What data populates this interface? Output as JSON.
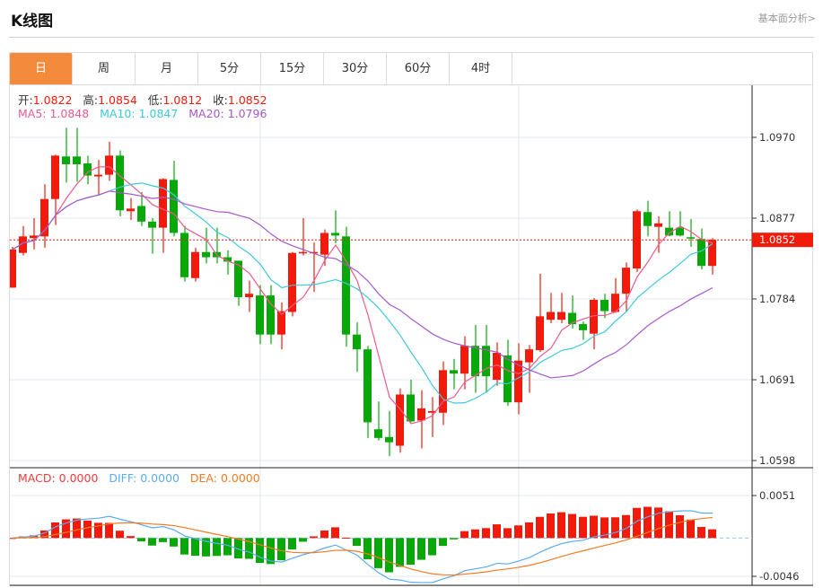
{
  "header": {
    "title": "K线图",
    "more_link": "基本面分析>"
  },
  "tabs": [
    {
      "label": "日",
      "active": true
    },
    {
      "label": "周"
    },
    {
      "label": "月"
    },
    {
      "label": "5分"
    },
    {
      "label": "15分"
    },
    {
      "label": "30分"
    },
    {
      "label": "60分"
    },
    {
      "label": "4时"
    }
  ],
  "info": {
    "open_label": "开:",
    "open": "1.0822",
    "high_label": "高:",
    "high": "1.0854",
    "low_label": "低:",
    "low": "1.0812",
    "close_label": "收:",
    "close": "1.0852",
    "ma5": "MA5: 1.0848",
    "ma10": "MA10: 1.0847",
    "ma20": "MA20: 1.0796"
  },
  "macd_info": {
    "macd": "MACD: 0.0000",
    "diff": "DIFF: 0.0000",
    "dea": "DEA: 0.0000"
  },
  "colors": {
    "up": "#f21a0b",
    "down": "#08a808",
    "ma5": "#ef5a8c",
    "ma10": "#3ec8dc",
    "ma20": "#a858c8",
    "diff": "#5aabf0",
    "dea": "#f57a20",
    "tab_active": "#f28c3c"
  },
  "chart_data": {
    "type": "candlestick",
    "ohlc_format": [
      "open",
      "high",
      "low",
      "close"
    ],
    "price_axis": {
      "ticks": [
        "1.0970",
        "1.0877",
        "1.0784",
        "1.0691",
        "1.0598"
      ],
      "ylim": [
        1.0598,
        1.097
      ]
    },
    "last_price_label": "1.0852",
    "last_price": 1.0852,
    "macd_axis": {
      "ticks": [
        "0.0051",
        "-0.0046"
      ],
      "ylim": [
        -0.0046,
        0.0051
      ]
    },
    "ma_periods": [
      5,
      10,
      20
    ],
    "ohlc": [
      [
        1.0797,
        1.0844,
        1.0797,
        1.0841
      ],
      [
        1.0837,
        1.0868,
        1.0834,
        1.0856
      ],
      [
        1.0854,
        1.0877,
        1.0841,
        1.0857
      ],
      [
        1.0856,
        1.0916,
        1.0843,
        1.0899
      ],
      [
        1.0899,
        1.095,
        1.0869,
        1.0949
      ],
      [
        1.0948,
        1.0981,
        1.0918,
        1.0939
      ],
      [
        1.0948,
        1.0981,
        1.0919,
        1.0939
      ],
      [
        1.094,
        1.0949,
        1.0916,
        1.0926
      ],
      [
        1.0925,
        1.0944,
        1.0904,
        1.0927
      ],
      [
        1.0927,
        1.0965,
        1.092,
        1.0949
      ],
      [
        1.0949,
        1.0955,
        1.0879,
        1.0886
      ],
      [
        1.0885,
        1.09,
        1.0875,
        1.0888
      ],
      [
        1.0891,
        1.0907,
        1.0868,
        1.0873
      ],
      [
        1.0873,
        1.0877,
        1.0836,
        1.0866
      ],
      [
        1.0866,
        1.0923,
        1.0837,
        1.0922
      ],
      [
        1.0921,
        1.0943,
        1.0856,
        1.086
      ],
      [
        1.086,
        1.0868,
        1.0804,
        1.0809
      ],
      [
        1.0808,
        1.0843,
        1.0804,
        1.0838
      ],
      [
        1.0838,
        1.0866,
        1.0825,
        1.0832
      ],
      [
        1.0838,
        1.0866,
        1.0825,
        1.0832
      ],
      [
        1.0832,
        1.084,
        1.0812,
        1.0827
      ],
      [
        1.0828,
        1.0828,
        1.0776,
        1.0786
      ],
      [
        1.0786,
        1.0805,
        1.0769,
        1.079
      ],
      [
        1.0788,
        1.08,
        1.0732,
        1.0743
      ],
      [
        1.0788,
        1.08,
        1.0732,
        1.0743
      ],
      [
        1.0743,
        1.078,
        1.0726,
        1.077
      ],
      [
        1.0769,
        1.0838,
        1.0764,
        1.0837
      ],
      [
        1.0837,
        1.0877,
        1.0834,
        1.0838
      ],
      [
        1.0837,
        1.0849,
        1.0792,
        1.0838
      ],
      [
        1.0835,
        1.0864,
        1.0822,
        1.086
      ],
      [
        1.086,
        1.0886,
        1.0848,
        1.0857
      ],
      [
        1.0856,
        1.0867,
        1.0729,
        1.0743
      ],
      [
        1.0743,
        1.0757,
        1.07,
        1.0726
      ],
      [
        1.0726,
        1.073,
        1.0624,
        1.0642
      ],
      [
        1.0634,
        1.0666,
        1.0621,
        1.0624
      ],
      [
        1.0625,
        1.0655,
        1.0603,
        1.0619
      ],
      [
        1.0615,
        1.0681,
        1.0607,
        1.0674
      ],
      [
        1.0674,
        1.0691,
        1.0642,
        1.0643
      ],
      [
        1.0644,
        1.0679,
        1.0612,
        1.0658
      ],
      [
        1.0653,
        1.0671,
        1.0625,
        1.0655
      ],
      [
        1.0653,
        1.0712,
        1.0639,
        1.0702
      ],
      [
        1.0702,
        1.0715,
        1.068,
        1.0698
      ],
      [
        1.0698,
        1.0741,
        1.068,
        1.073
      ],
      [
        1.073,
        1.0754,
        1.0676,
        1.0695
      ],
      [
        1.073,
        1.0754,
        1.0676,
        1.0695
      ],
      [
        1.0691,
        1.0734,
        1.0684,
        1.0722
      ],
      [
        1.0719,
        1.0737,
        1.0661,
        1.0665
      ],
      [
        1.0665,
        1.0733,
        1.0651,
        1.0713
      ],
      [
        1.0711,
        1.0731,
        1.0676,
        1.0726
      ],
      [
        1.0725,
        1.0813,
        1.0723,
        1.0764
      ],
      [
        1.076,
        1.0791,
        1.0756,
        1.0769
      ],
      [
        1.076,
        1.0791,
        1.0756,
        1.0769
      ],
      [
        1.0768,
        1.0788,
        1.075,
        1.0755
      ],
      [
        1.0755,
        1.0758,
        1.0737,
        1.0748
      ],
      [
        1.0744,
        1.0785,
        1.0726,
        1.0783
      ],
      [
        1.0783,
        1.079,
        1.0762,
        1.077
      ],
      [
        1.0769,
        1.0808,
        1.0768,
        1.079
      ],
      [
        1.079,
        1.0826,
        1.0769,
        1.082
      ],
      [
        1.0819,
        1.0887,
        1.0815,
        1.0885
      ],
      [
        1.0884,
        1.0897,
        1.0856,
        1.0868
      ],
      [
        1.0867,
        1.0879,
        1.0837,
        1.0871
      ],
      [
        1.0866,
        1.0885,
        1.0856,
        1.0857
      ],
      [
        1.0866,
        1.0885,
        1.0856,
        1.0857
      ],
      [
        1.0855,
        1.0876,
        1.0844,
        1.0854
      ],
      [
        1.0853,
        1.0865,
        1.0818,
        1.0822
      ],
      [
        1.0822,
        1.0854,
        1.0812,
        1.0852
      ]
    ]
  }
}
